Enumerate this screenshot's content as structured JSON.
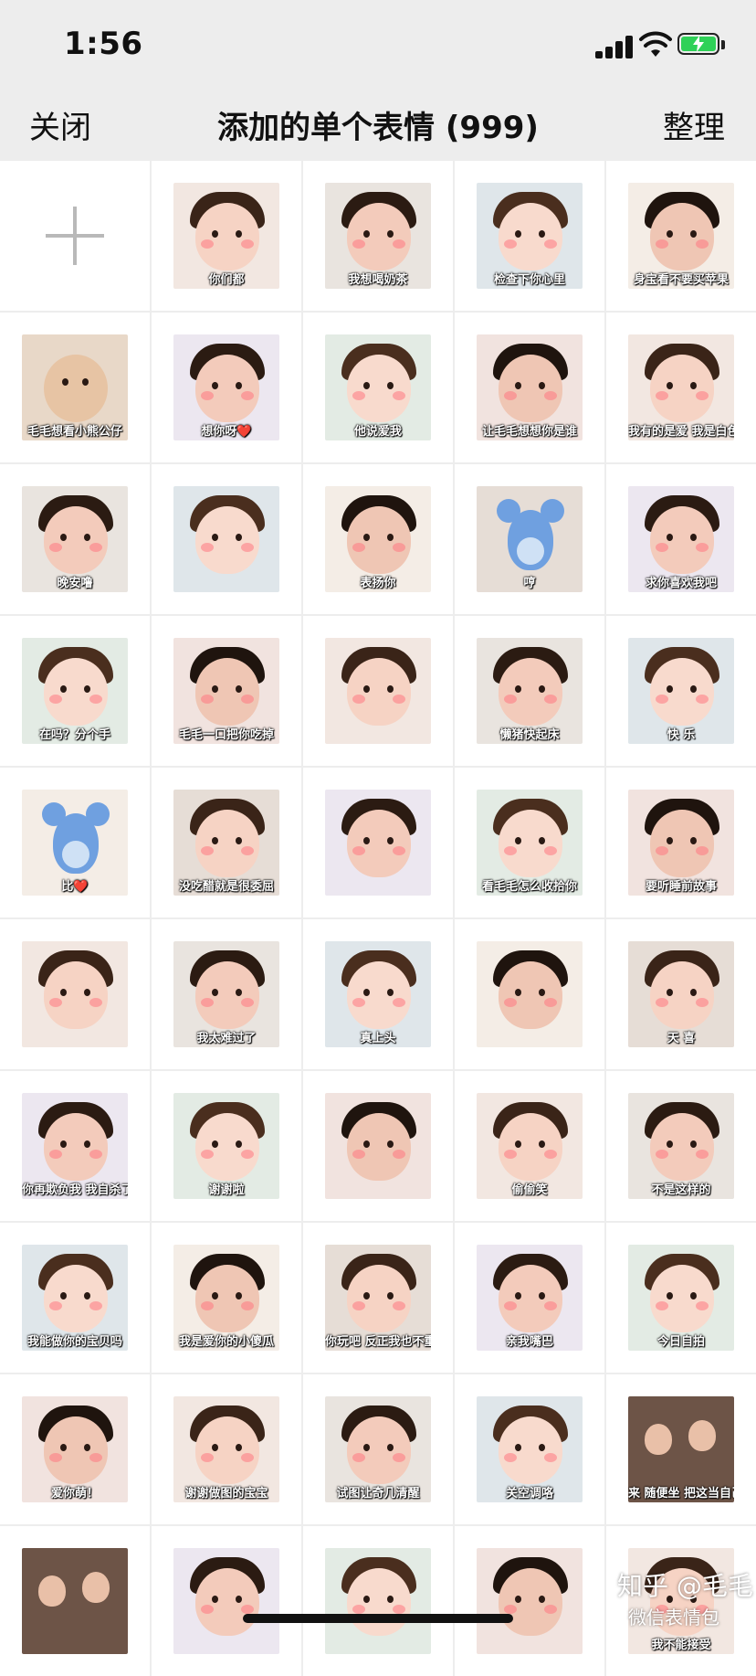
{
  "status_bar": {
    "time": "1:56"
  },
  "nav": {
    "close_label": "关闭",
    "title": "添加的单个表情 (999)",
    "organize_label": "整理"
  },
  "grid": {
    "add_button": {
      "icon": "plus-icon"
    },
    "stickers": [
      {
        "caption": "你们都",
        "theme": "baby"
      },
      {
        "caption": "我想喝奶茶",
        "theme": "baby"
      },
      {
        "caption": "检查下你心里",
        "theme": "baby"
      },
      {
        "caption": "身宝看不要买苹果",
        "theme": "baby"
      },
      {
        "caption": "毛毛想看小熊公仔",
        "theme": "bear"
      },
      {
        "caption": "想你呀❤️",
        "theme": "baby"
      },
      {
        "caption": "他说爱我",
        "theme": "baby"
      },
      {
        "caption": "让毛毛想想你是谁",
        "theme": "baby"
      },
      {
        "caption": "我有的是爱 我是白色大海",
        "theme": "baby"
      },
      {
        "caption": "晚安噜",
        "theme": "baby"
      },
      {
        "caption": "",
        "theme": "baby"
      },
      {
        "caption": "表扬你",
        "theme": "baby"
      },
      {
        "caption": "哼",
        "theme": "mouse"
      },
      {
        "caption": "求你喜欢我吧",
        "theme": "baby"
      },
      {
        "caption": "在吗？分个手",
        "theme": "baby"
      },
      {
        "caption": "毛毛一口把你吃掉",
        "theme": "baby"
      },
      {
        "caption": "",
        "theme": "baby"
      },
      {
        "caption": "懒猪快起床",
        "theme": "baby"
      },
      {
        "caption": "快 乐",
        "theme": "baby"
      },
      {
        "caption": "比❤️",
        "theme": "mouse"
      },
      {
        "caption": "没吃醋就是很委屈",
        "theme": "baby"
      },
      {
        "caption": "",
        "theme": "baby"
      },
      {
        "caption": "看毛毛怎么收拾你",
        "theme": "baby"
      },
      {
        "caption": "要听睡前故事",
        "theme": "baby"
      },
      {
        "caption": "",
        "theme": "baby"
      },
      {
        "caption": "我太难过了",
        "theme": "baby"
      },
      {
        "caption": "真上头",
        "theme": "baby"
      },
      {
        "caption": "",
        "theme": "baby"
      },
      {
        "caption": "天 喜",
        "theme": "baby"
      },
      {
        "caption": "你再欺负我 我自杀了",
        "theme": "baby"
      },
      {
        "caption": "谢谢啦",
        "theme": "baby"
      },
      {
        "caption": "",
        "theme": "baby"
      },
      {
        "caption": "偷偷笑",
        "theme": "baby"
      },
      {
        "caption": "不是这样的",
        "theme": "baby"
      },
      {
        "caption": "我能做你的宝贝吗",
        "theme": "baby"
      },
      {
        "caption": "我是爱你的小傻瓜",
        "theme": "baby"
      },
      {
        "caption": "你玩吧 反正我也不重要",
        "theme": "baby"
      },
      {
        "caption": "亲我嘴巴",
        "theme": "baby"
      },
      {
        "caption": "今日自拍",
        "theme": "baby"
      },
      {
        "caption": "爱你萌！",
        "theme": "baby"
      },
      {
        "caption": "谢谢做图的宝宝",
        "theme": "baby"
      },
      {
        "caption": "试图让奇几清醒",
        "theme": "baby"
      },
      {
        "caption": "关空调咯",
        "theme": "baby"
      },
      {
        "caption": "来 随便坐 把这当自己家",
        "theme": "scene"
      },
      {
        "caption": "",
        "theme": "scene"
      },
      {
        "caption": "",
        "theme": "baby"
      },
      {
        "caption": "",
        "theme": "baby"
      },
      {
        "caption": "",
        "theme": "baby"
      },
      {
        "caption": "我不能接受",
        "theme": "baby"
      }
    ]
  },
  "watermark": {
    "line1": "知乎 @毛毛",
    "line2": "微信表情包"
  },
  "colors": {
    "background": "#ededed",
    "cell": "#ffffff",
    "battery_green": "#2fd158",
    "plus": "#b9b9b9"
  }
}
